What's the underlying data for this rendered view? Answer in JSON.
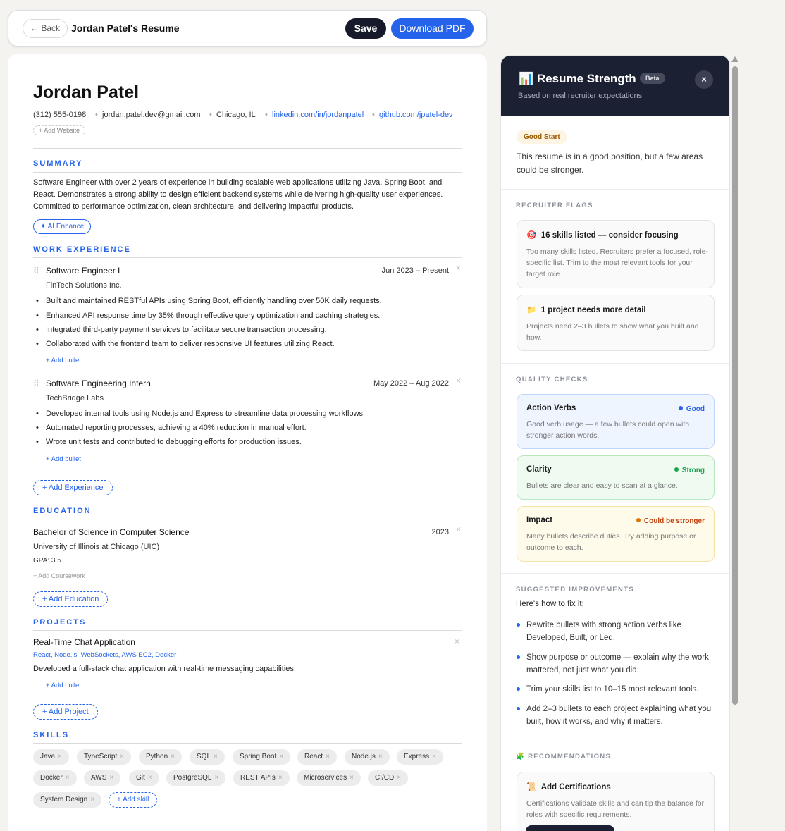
{
  "topbar": {
    "back": "← Back",
    "title": "Jordan Patel's Resume",
    "save": "Save",
    "download": "Download PDF"
  },
  "resume": {
    "name": "Jordan Patel",
    "phone": "(312) 555-0198",
    "email": "jordan.patel.dev@gmail.com",
    "location": "Chicago, IL",
    "linkedin": "linkedin.com/in/jordanpatel",
    "github": "github.com/jpatel-dev",
    "add_website": "+ Add Website",
    "sections": {
      "summary": "SUMMARY",
      "experience": "WORK EXPERIENCE",
      "education": "EDUCATION",
      "projects": "PROJECTS",
      "skills": "SKILLS"
    },
    "summary": "Software Engineer with over 2 years of experience in building scalable web applications utilizing Java, Spring Boot, and React. Demonstrates a strong ability to design efficient backend systems while delivering high-quality user experiences. Committed to performance optimization, clean architecture, and delivering impactful products.",
    "ai_enhance": "✦ AI Enhance",
    "jobs": [
      {
        "title": "Software Engineer I",
        "company": "FinTech Solutions Inc.",
        "dates": "Jun 2023 – Present",
        "bullets": [
          "Built and maintained RESTful APIs using Spring Boot, efficiently handling over 50K daily requests.",
          "Enhanced API response time by 35% through effective query optimization and caching strategies.",
          "Integrated third-party payment services to facilitate secure transaction processing.",
          "Collaborated with the frontend team to deliver responsive UI features utilizing React."
        ]
      },
      {
        "title": "Software Engineering Intern",
        "company": "TechBridge Labs",
        "dates": "May 2022 – Aug 2022",
        "bullets": [
          "Developed internal tools using Node.js and Express to streamline data processing workflows.",
          "Automated reporting processes, achieving a 40% reduction in manual effort.",
          "Wrote unit tests and contributed to debugging efforts for production issues."
        ]
      }
    ],
    "add_bullet": "+ Add bullet",
    "add_experience": "+ Add Experience",
    "education": {
      "degree": "Bachelor of Science in Computer Science",
      "school": "University of Illinois at Chicago (UIC)",
      "year": "2023",
      "gpa": "GPA: 3.5",
      "add_coursework": "+ Add Coursework"
    },
    "add_education": "+ Add Education",
    "project": {
      "title": "Real-Time Chat Application",
      "tech": "React, Node.js, WebSockets, AWS EC2, Docker",
      "desc": "Developed a full-stack chat application with real-time messaging capabilities."
    },
    "add_project": "+ Add Project",
    "skills": [
      "Java",
      "TypeScript",
      "Python",
      "SQL",
      "Spring Boot",
      "React",
      "Node.js",
      "Express",
      "Docker",
      "AWS",
      "Git",
      "PostgreSQL",
      "REST APIs",
      "Microservices",
      "CI/CD",
      "System Design"
    ],
    "add_skill": "+ Add skill",
    "remove_glyph": "×",
    "drag_glyph": "⠿",
    "bullet_glyph": "•",
    "sep_glyph": "•"
  },
  "panel": {
    "title": "📊 Resume Strength",
    "beta": "Beta",
    "subtitle": "Based on real recruiter expectations",
    "close": "×",
    "rating": "Good Start",
    "rating_desc": "This resume is in a good position, but a few areas could be stronger.",
    "recruiter_flags_label": "RECRUITER FLAGS",
    "flags": [
      {
        "icon": "🎯",
        "title": "16 skills listed — consider focusing",
        "desc": "Too many skills listed. Recruiters prefer a focused, role-specific list. Trim to the most relevant tools for your target role."
      },
      {
        "icon": "📁",
        "title": "1 project needs more detail",
        "desc": "Projects need 2–3 bullets to show what you built and how."
      }
    ],
    "quality_label": "QUALITY CHECKS",
    "checks": [
      {
        "title": "Action Verbs",
        "status": "Good",
        "color": "#2563eb",
        "desc": "Good verb usage — a few bullets could open with stronger action words."
      },
      {
        "title": "Clarity",
        "status": "Strong",
        "color": "#16a34a",
        "desc": "Bullets are clear and easy to scan at a glance."
      },
      {
        "title": "Impact",
        "status": "Could be stronger",
        "color": "#d97706",
        "desc": "Many bullets describe duties. Try adding purpose or outcome to each."
      }
    ],
    "suggested_label": "SUGGESTED IMPROVEMENTS",
    "suggested_intro": "Here's how to fix it:",
    "suggestions": [
      "Rewrite bullets with strong action verbs like Developed, Built, or Led.",
      "Show purpose or outcome — explain why the work mattered, not just what you did.",
      "Trim your skills list to 10–15 most relevant tools.",
      "Add 2–3 bullets to each project explaining what you built, how it works, and why it matters."
    ],
    "recommendations_label": "🧩 RECOMMENDATIONS",
    "recommendation": {
      "icon": "📜",
      "title": "Add Certifications",
      "desc": "Certifications validate skills and can tip the balance for roles with specific requirements."
    }
  }
}
